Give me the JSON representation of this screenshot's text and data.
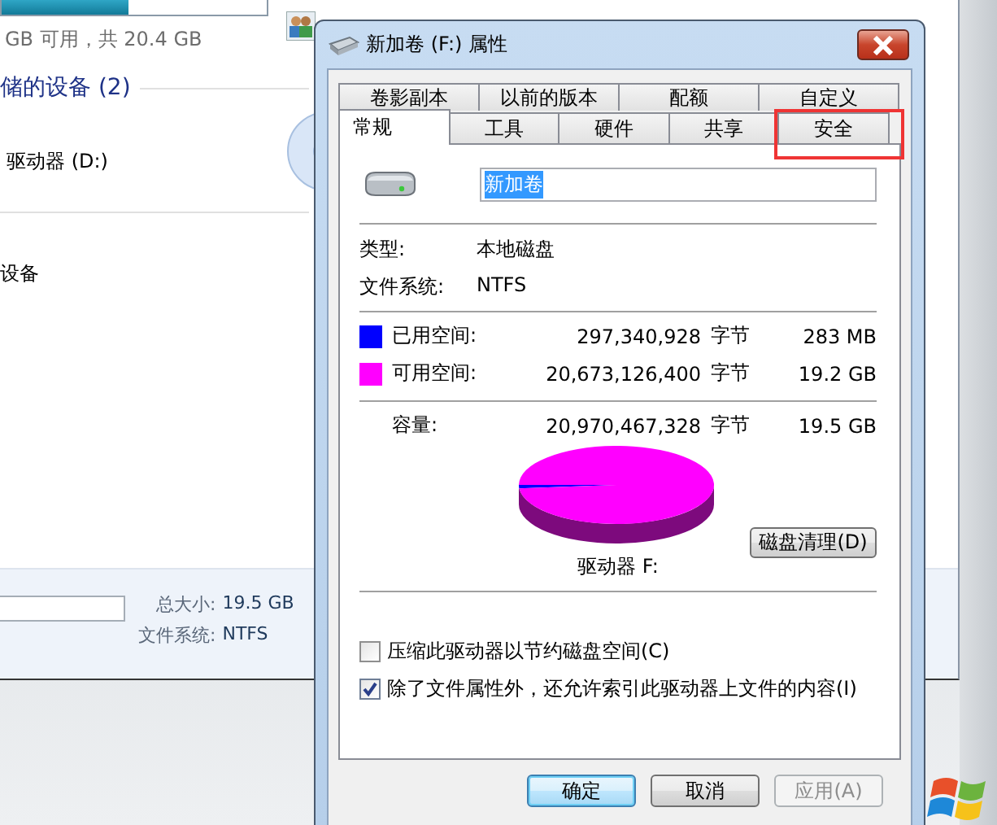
{
  "explorer": {
    "free_text": "GB 可用，共 20.4 GB",
    "section_heading": "储的设备 (2)",
    "drive_label": "驱动器 (D:)",
    "section_item": "设备",
    "details": [
      {
        "label": "总大小:",
        "value": "19.5 GB"
      },
      {
        "label": "文件系统:",
        "value": "NTFS"
      }
    ]
  },
  "dialog": {
    "title": "新加卷 (F:) 属性",
    "tabs_back": [
      {
        "label": "卷影副本",
        "selected": false,
        "highlighted": false
      },
      {
        "label": "以前的版本",
        "selected": false,
        "highlighted": false
      },
      {
        "label": "配额",
        "selected": false,
        "highlighted": false
      },
      {
        "label": "自定义",
        "selected": false,
        "highlighted": false
      }
    ],
    "tabs_front": [
      {
        "label": "常规",
        "selected": true,
        "highlighted": false
      },
      {
        "label": "工具",
        "selected": false,
        "highlighted": false
      },
      {
        "label": "硬件",
        "selected": false,
        "highlighted": false
      },
      {
        "label": "共享",
        "selected": false,
        "highlighted": false
      },
      {
        "label": "安全",
        "selected": false,
        "highlighted": true
      }
    ],
    "volume_name": {
      "value": "新加卷",
      "text_selected": true
    },
    "info": [
      {
        "label": "类型:",
        "value": "本地磁盘"
      },
      {
        "label": "文件系统:",
        "value": "NTFS"
      }
    ],
    "space": [
      {
        "label": "已用空间:",
        "bytes": "297,340,928",
        "unit": "字节",
        "size": "283 MB",
        "color": "#0000ff"
      },
      {
        "label": "可用空间:",
        "bytes": "20,673,126,400",
        "unit": "字节",
        "size": "19.2 GB",
        "color": "#ff00ff"
      }
    ],
    "capacity": {
      "label": "容量:",
      "bytes": "20,970,467,328",
      "unit": "字节",
      "size": "19.5 GB"
    },
    "drive_caption": "驱动器 F:",
    "cleanup_button": "磁盘清理(D)",
    "options": [
      {
        "label": "压缩此驱动器以节约磁盘空间(C)",
        "checked": false
      },
      {
        "label": "除了文件属性外，还允许索引此驱动器上文件的内容(I)",
        "checked": true
      }
    ],
    "buttons": [
      {
        "label": "确定",
        "default": true,
        "disabled": false
      },
      {
        "label": "取消",
        "default": false,
        "disabled": false
      },
      {
        "label": "应用(A)",
        "default": false,
        "disabled": true
      }
    ]
  }
}
